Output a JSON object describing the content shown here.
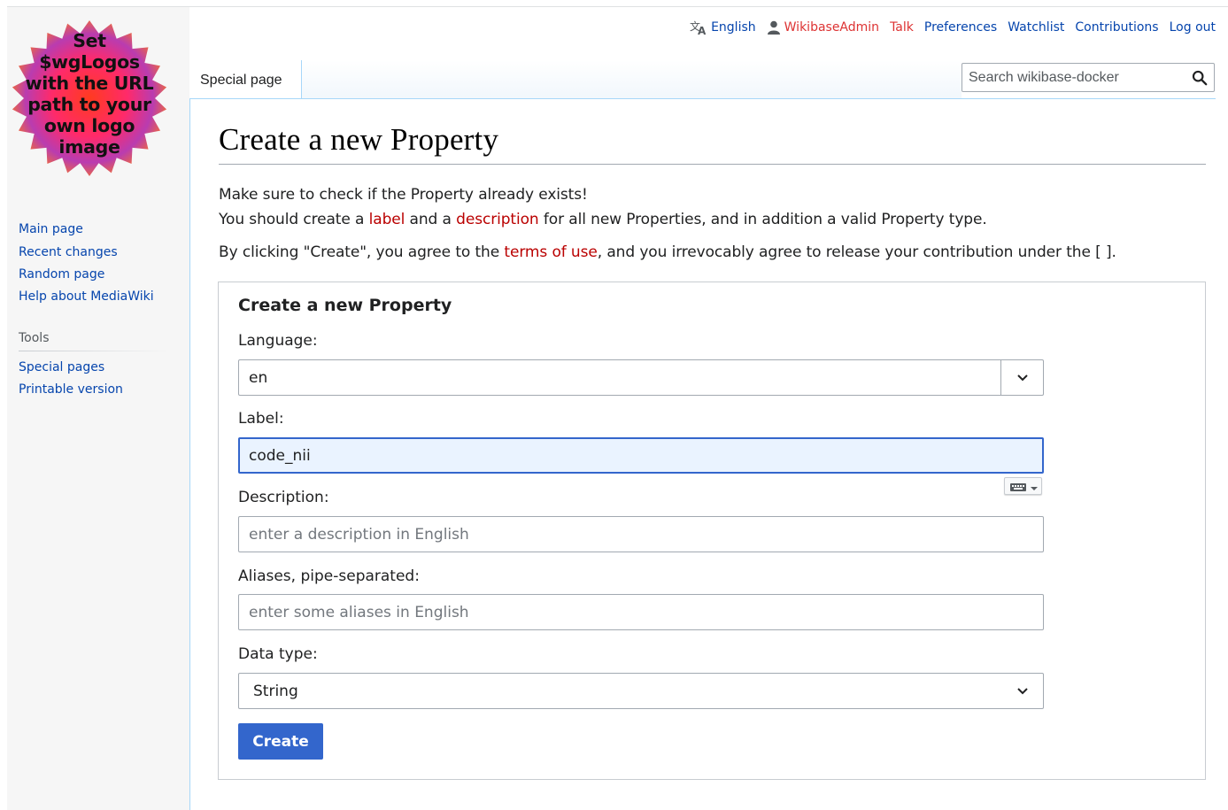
{
  "logo": {
    "lines": [
      "Set",
      "$wgLogos",
      "with the URL",
      "path to your",
      "own logo",
      "image"
    ]
  },
  "sidebar": {
    "nav_items": [
      {
        "label": "Main page"
      },
      {
        "label": "Recent changes"
      },
      {
        "label": "Random page"
      },
      {
        "label": "Help about MediaWiki"
      }
    ],
    "tools_heading": "Tools",
    "tools_items": [
      {
        "label": "Special pages"
      },
      {
        "label": "Printable version"
      }
    ]
  },
  "personal_tools": {
    "language": "English",
    "user": "WikibaseAdmin",
    "talk": "Talk",
    "preferences": "Preferences",
    "watchlist": "Watchlist",
    "contributions": "Contributions",
    "logout": "Log out"
  },
  "tabs": {
    "special_page": "Special page"
  },
  "search": {
    "placeholder": "Search wikibase-docker",
    "value": ""
  },
  "page": {
    "title": "Create a new Property",
    "intro1": "Make sure to check if the Property already exists!",
    "intro2_a": "You should create a ",
    "intro2_label_link": "label",
    "intro2_b": " and a ",
    "intro2_description_link": "description",
    "intro2_c": " for all new Properties, and in addition a valid Property type.",
    "terms_a": "By clicking \"Create\", you agree to the ",
    "terms_link": "terms of use",
    "terms_b": ", and you irrevocably agree to release your contribution under the [ ]."
  },
  "form": {
    "legend": "Create a new Property",
    "language_label": "Language:",
    "language_value": "en",
    "label_label": "Label:",
    "label_value": "code_nii",
    "description_label": "Description:",
    "description_placeholder": "enter a description in English",
    "description_value": "",
    "aliases_label": "Aliases, pipe-separated:",
    "aliases_placeholder": "enter some aliases in English",
    "aliases_value": "",
    "datatype_label": "Data type:",
    "datatype_value": "String",
    "create_button": "Create"
  },
  "colors": {
    "link": "#0645ad",
    "redlink": "#d33",
    "progressive": "#3366cc",
    "sidebar_bg": "#f6f6f6"
  }
}
